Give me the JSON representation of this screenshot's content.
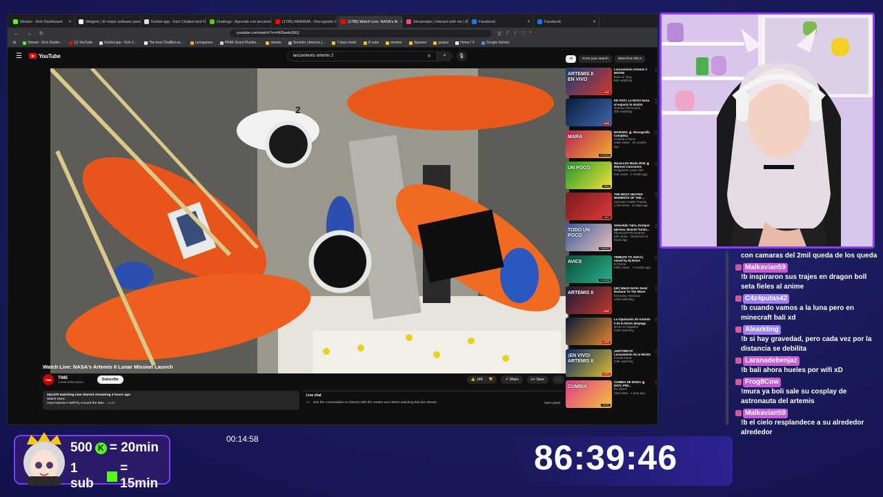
{
  "browser": {
    "tabs": [
      {
        "label": "Stream - Kick Dashboard",
        "color": "#53fc18",
        "active": false
      },
      {
        "label": "Widgets | El mejor software para j",
        "color": "#ffffff",
        "active": false
      },
      {
        "label": "Kicklet.app - Kick Chatbot and Ov",
        "color": "#dddddd",
        "active": false
      },
      {
        "label": "Duolingo - Aprende con lecciones",
        "color": "#58cc02",
        "active": false
      },
      {
        "label": "(1785) MARAMA - Discografía C",
        "color": "#ff0000",
        "active": false
      },
      {
        "label": "(1785) Watch Live: NASA's Ar",
        "color": "#ff0000",
        "active": true
      },
      {
        "label": "Streamlabs | Interact with me | Be",
        "color": "#ff4b6e",
        "active": false
      },
      {
        "label": "Facebook",
        "color": "#1877f2",
        "active": false
      },
      {
        "label": "Facebook",
        "color": "#1877f2",
        "active": false
      }
    ],
    "url": "youtube.com/watch?v=nW3wekc56Q",
    "bookmarks": [
      {
        "label": "Stream - Kick Dashb...",
        "color": "#53fc18"
      },
      {
        "label": "(1) YouTube",
        "color": "#ff0000"
      },
      {
        "label": "Kicklet.app - Kick C...",
        "color": "#dddddd"
      },
      {
        "label": "The best ChatBot an...",
        "color": "#ffffff"
      },
      {
        "label": "Lexogames",
        "color": "#f5a623"
      },
      {
        "label": "PRAK Scout Plushie...",
        "color": "#cccccc"
      },
      {
        "label": "stream",
        "color": "#f5c518"
      },
      {
        "label": "Servidor | Aternos |...",
        "color": "#aaaaaa"
      },
      {
        "label": "7 days mods",
        "color": "#f5c518"
      },
      {
        "label": "R subs",
        "color": "#f5c518"
      },
      {
        "label": "emotes",
        "color": "#f5c518"
      },
      {
        "label": "Japones",
        "color": "#f5c518"
      },
      {
        "label": "juegos",
        "color": "#f5c518"
      },
      {
        "label": "Home / X",
        "color": "#ffffff"
      },
      {
        "label": "Google Gemini",
        "color": "#4f8cff"
      }
    ]
  },
  "youtube": {
    "logo": "YouTube",
    "search_query": "lanzamiento artemis 2",
    "video_title": "Watch Live: NASA's Artemis II Lunar Mission Launch",
    "channel": {
      "name": "TIME",
      "subs": "1.54M subscribers",
      "avatar_text": "TIME"
    },
    "subscribe_label": "Subscribe",
    "actions": {
      "likes": "14K",
      "share": "Share",
      "save": "Save"
    },
    "description": {
      "line1": "152,670 watching now  Started streaming 4 hours ago",
      "line2": "Watch More:",
      "line3": "How Artemis II Will Fly Around the Moo",
      "more": "...more"
    },
    "live_chat": {
      "title": "Live chat",
      "prompt": "Join the conversation to interact with the creator and others watching this live stream.",
      "open_panel": "Open panel"
    },
    "chips": [
      "All",
      "From your search",
      "More from this s"
    ],
    "recommendations": [
      {
        "title": "Lanzamiento Artemis 2 MOONI",
        "channel": "Date un Vlog",
        "meta": "96K watching",
        "badge": "LIVE",
        "c1": "#1a3a7a",
        "c2": "#d23a2a",
        "thumb_text": "ARTEMIS II EN VIVO"
      },
      {
        "title": "EN VIVO: La NASA lanza al espacio la misión Artemis II",
        "channel": "Noticias Telemundo",
        "meta": "30K watching",
        "badge": "LIVE",
        "c1": "#0b1a3a",
        "c2": "#3a6ab0",
        "thumb_text": ""
      },
      {
        "title": "MARAMA 🔥 Discografía Completa",
        "channel": "Cumbia y Piena",
        "meta": "246K views · 10 months ago",
        "badge": "1:16:21",
        "c1": "#b8235a",
        "c2": "#f3b32a",
        "thumb_text": "MARA"
      },
      {
        "title": "Musica De Moda 2026 🔥 Mejores Canciones",
        "channel": "Reggaeton Latino Mix",
        "meta": "94K views · 1 month ago",
        "badge": "New",
        "c1": "#1e9a2a",
        "c2": "#f5e23a",
        "thumb_text": "UN POCO"
      },
      {
        "title": "THE MOST HEATED MOMENTS OF THE ...",
        "channel": "Sylvester Gaden Puasta",
        "meta": "1.3M views · 11 days ago",
        "badge": "New",
        "c1": "#7a1a1a",
        "c2": "#e03a3a",
        "thumb_text": ""
      },
      {
        "title": "Sebastián Yatra, Enrique Iglesias, Manuel Turizo...",
        "channel": "REGGAETON NUEVO",
        "meta": "60K views · Streamed 14 hours ago",
        "badge": "1:46:02",
        "c1": "#3a5aa0",
        "c2": "#e9c2b8",
        "thumb_text": "TODO UN POCO"
      },
      {
        "title": "TRIBUTE TO AVICII | mixed by Dj Remo",
        "channel": "Dj Remo",
        "meta": "530K views · 7 months ago",
        "badge": "1:06:36",
        "c1": "#0a4a3a",
        "c2": "#2ab08a",
        "thumb_text": "AVICII"
      },
      {
        "title": "[4K] Watch NASA Send Humans To The Moon LIVE!! #Artemis2",
        "channel": "Everyday Astronaut",
        "meta": "131K watching",
        "badge": "LIVE",
        "c1": "#1a1a3a",
        "c2": "#c03a2a",
        "thumb_text": "ARTEMIS II"
      },
      {
        "title": "La tripulación de Artemis II de la NASA despega hacia la Lun...",
        "channel": "NASA en Español",
        "meta": "310K watching",
        "badge": "LIVE",
        "c1": "#0a1a3a",
        "c2": "#e08a2a",
        "thumb_text": ""
      },
      {
        "title": "¡HISTÓRICO! Lanzamiento de la Misión Artemis II de la ...",
        "channel": "Florida News",
        "meta": "3.9K watching",
        "badge": "LIVE",
        "c1": "#0a2a6a",
        "c2": "#e0c02a",
        "thumb_text": "¡EN VIVO! ARTEMIS II"
      },
      {
        "title": "CUMBIA DE MODA 🔥 (HOY, PIEL, PERDONARTE PARA QU...",
        "channel": "DJ Diesel",
        "meta": "11M views · 1 year ago",
        "badge": "24:01",
        "c1": "#e03a8a",
        "c2": "#f5c23a",
        "thumb_text": "CUMBIA"
      }
    ]
  },
  "chat": {
    "messages": [
      {
        "user": "",
        "color": "",
        "text": "con camaras del 2mil queda de los queda"
      },
      {
        "user": "Malkavian59",
        "color": "#c45cd6",
        "text": "!b inspiraron sus trajes en dragon boll seta fieles al anime"
      },
      {
        "user": "C4z4putas42",
        "color": "#9b7ff5",
        "text": "!b cuando vamos a la luna pero en minecraft bali xd"
      },
      {
        "user": "Alearkting",
        "color": "#9b7ff5",
        "text": "!b si hay gravedad, pero cada vez por la distancia se debilita"
      },
      {
        "user": "Laranadebenjaz",
        "color": "#c45cd6",
        "text": "!b bali ahora hueles por wifi xD"
      },
      {
        "user": "Frog8Cow",
        "color": "#c45cd6",
        "text": "!mura ya boli sale su cosplay de astronauta del artemis"
      },
      {
        "user": "Malkavian59",
        "color": "#c45cd6",
        "text": "!b el cielo resplandece a su alrededor alrededor"
      }
    ]
  },
  "overlay": {
    "promo_line1_amount": "500",
    "promo_line1_value": "= 20min",
    "promo_line2_amount": "1 sub",
    "promo_line2_value": "= 15min",
    "coin_glyph": "K",
    "small_timer": "00:14:58",
    "big_timer": "86:39:46"
  }
}
